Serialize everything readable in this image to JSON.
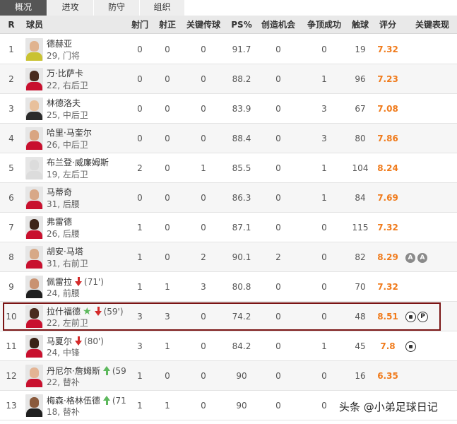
{
  "tabs": [
    "概况",
    "进攻",
    "防守",
    "组织"
  ],
  "active_tab": "概况",
  "columns": [
    "R",
    "球员",
    "射门",
    "射正",
    "关键传球",
    "PS%",
    "创造机会",
    "争顶成功",
    "触球",
    "评分",
    "关键表现"
  ],
  "players": [
    {
      "r": "1",
      "name": "德赫亚",
      "age_pos": "29, 门将",
      "shots": "0",
      "on_target": "0",
      "key_passes": "0",
      "ps": "91.7",
      "chances": "0",
      "aerials": "0",
      "touches": "19",
      "rating": "7.32",
      "sub": null,
      "minute": "",
      "star": false,
      "key_icons": [],
      "avatar_skin": "#e0b38f",
      "avatar_shirt": "#c9c232"
    },
    {
      "r": "2",
      "name": "万·比萨卡",
      "age_pos": "22, 右后卫",
      "shots": "0",
      "on_target": "0",
      "key_passes": "0",
      "ps": "88.2",
      "chances": "0",
      "aerials": "1",
      "touches": "96",
      "rating": "7.23",
      "sub": null,
      "minute": "",
      "star": false,
      "key_icons": [],
      "avatar_skin": "#4a2c1f",
      "avatar_shirt": "#c8102e"
    },
    {
      "r": "3",
      "name": "林德洛夫",
      "age_pos": "25, 中后卫",
      "shots": "0",
      "on_target": "0",
      "key_passes": "0",
      "ps": "83.9",
      "chances": "0",
      "aerials": "3",
      "touches": "67",
      "rating": "7.08",
      "sub": null,
      "minute": "",
      "star": false,
      "key_icons": [],
      "avatar_skin": "#e8c09c",
      "avatar_shirt": "#2b2b2b"
    },
    {
      "r": "4",
      "name": "哈里·马奎尔",
      "age_pos": "26, 中后卫",
      "shots": "0",
      "on_target": "0",
      "key_passes": "0",
      "ps": "88.4",
      "chances": "0",
      "aerials": "3",
      "touches": "80",
      "rating": "7.86",
      "sub": null,
      "minute": "",
      "star": false,
      "key_icons": [],
      "avatar_skin": "#d9a582",
      "avatar_shirt": "#c8102e"
    },
    {
      "r": "5",
      "name": "布兰登·威廉姆斯",
      "age_pos": "19, 左后卫",
      "shots": "2",
      "on_target": "0",
      "key_passes": "1",
      "ps": "85.5",
      "chances": "0",
      "aerials": "1",
      "touches": "104",
      "rating": "8.24",
      "sub": null,
      "minute": "",
      "star": false,
      "key_icons": [],
      "avatar_skin": "#dcdcdc",
      "avatar_shirt": "#dcdcdc"
    },
    {
      "r": "6",
      "name": "马蒂奇",
      "age_pos": "31, 后腰",
      "shots": "0",
      "on_target": "0",
      "key_passes": "0",
      "ps": "86.3",
      "chances": "0",
      "aerials": "1",
      "touches": "84",
      "rating": "7.69",
      "sub": null,
      "minute": "",
      "star": false,
      "key_icons": [],
      "avatar_skin": "#d8a888",
      "avatar_shirt": "#c8102e"
    },
    {
      "r": "7",
      "name": "弗雷德",
      "age_pos": "26, 后腰",
      "shots": "1",
      "on_target": "0",
      "key_passes": "0",
      "ps": "87.1",
      "chances": "0",
      "aerials": "0",
      "touches": "115",
      "rating": "7.32",
      "sub": null,
      "minute": "",
      "star": false,
      "key_icons": [],
      "avatar_skin": "#3d2418",
      "avatar_shirt": "#c8102e"
    },
    {
      "r": "8",
      "name": "胡安·马塔",
      "age_pos": "31, 右前卫",
      "shots": "1",
      "on_target": "0",
      "key_passes": "2",
      "ps": "90.1",
      "chances": "2",
      "aerials": "0",
      "touches": "82",
      "rating": "8.29",
      "sub": null,
      "minute": "",
      "star": false,
      "key_icons": [
        "A",
        "A"
      ],
      "avatar_skin": "#d7a987",
      "avatar_shirt": "#c8102e"
    },
    {
      "r": "9",
      "name": "佩雷拉",
      "age_pos": "24, 前腰",
      "shots": "1",
      "on_target": "1",
      "key_passes": "3",
      "ps": "80.8",
      "chances": "0",
      "aerials": "0",
      "touches": "70",
      "rating": "7.32",
      "sub": "out",
      "minute": "(71')",
      "star": false,
      "key_icons": [],
      "avatar_skin": "#c99271",
      "avatar_shirt": "#1f1f1f"
    },
    {
      "r": "10",
      "name": "拉什福德",
      "age_pos": "22, 左前卫",
      "shots": "3",
      "on_target": "3",
      "key_passes": "0",
      "ps": "74.2",
      "chances": "0",
      "aerials": "0",
      "touches": "48",
      "rating": "8.51",
      "sub": "out",
      "minute": "(59')",
      "star": true,
      "key_icons": [
        "ball",
        "pen"
      ],
      "avatar_skin": "#4a2c1f",
      "avatar_shirt": "#c8102e"
    },
    {
      "r": "11",
      "name": "马夏尔",
      "age_pos": "24, 中锋",
      "shots": "3",
      "on_target": "1",
      "key_passes": "0",
      "ps": "84.2",
      "chances": "0",
      "aerials": "1",
      "touches": "45",
      "rating": "7.8",
      "sub": "out",
      "minute": "(80')",
      "star": false,
      "key_icons": [
        "ball"
      ],
      "avatar_skin": "#3a2216",
      "avatar_shirt": "#c8102e"
    },
    {
      "r": "12",
      "name": "丹尼尔·詹姆斯",
      "age_pos": "22, 替补",
      "shots": "1",
      "on_target": "0",
      "key_passes": "0",
      "ps": "90",
      "chances": "0",
      "aerials": "0",
      "touches": "16",
      "rating": "6.35",
      "sub": "in",
      "minute": "(59",
      "star": false,
      "key_icons": [],
      "avatar_skin": "#e3b494",
      "avatar_shirt": "#c8102e"
    },
    {
      "r": "13",
      "name": "梅森·格林伍德",
      "age_pos": "18, 替补",
      "shots": "1",
      "on_target": "1",
      "key_passes": "0",
      "ps": "90",
      "chances": "0",
      "aerials": "0",
      "touches": "",
      "rating": "",
      "sub": "in",
      "minute": "(71",
      "star": false,
      "key_icons": [],
      "avatar_skin": "#8a5a3c",
      "avatar_shirt": "#1f1f1f"
    }
  ],
  "watermark": "头条 @小弟足球日记",
  "colors": {
    "rating": "#f07b1c",
    "highlight_border": "#7a1414",
    "sub_out": "#d42b2b",
    "sub_in": "#5cb85c",
    "active_tab": "#555555"
  }
}
